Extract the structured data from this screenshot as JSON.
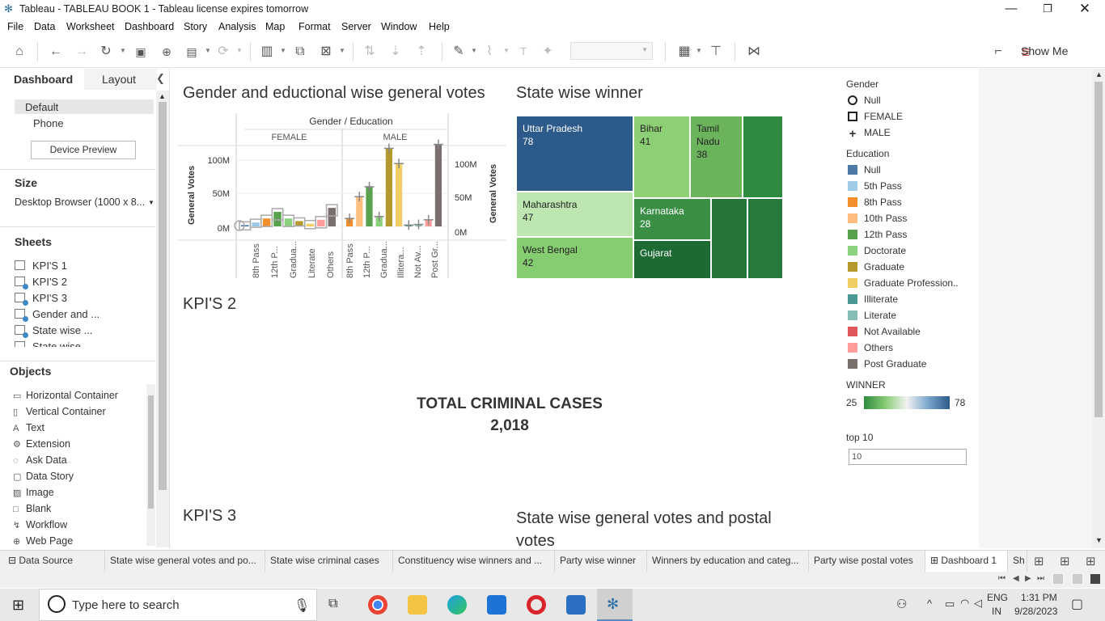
{
  "window": {
    "title": "Tableau - TABLEAU BOOK 1 - Tableau license expires tomorrow"
  },
  "menu": [
    "File",
    "Data",
    "Worksheet",
    "Dashboard",
    "Story",
    "Analysis",
    "Map",
    "Format",
    "Server",
    "Window",
    "Help"
  ],
  "toolbar": {
    "show_me": "Show Me"
  },
  "left_pane": {
    "tab_dashboard": "Dashboard",
    "tab_layout": "Layout",
    "devices": {
      "default": "Default",
      "phone": "Phone",
      "preview_button": "Device Preview"
    },
    "size": {
      "heading": "Size",
      "value": "Desktop Browser (1000 x 8..."
    },
    "sheets": {
      "heading": "Sheets",
      "items": [
        "KPI'S 1",
        "KPI'S 2",
        "KPI'S 3",
        "Gender and ...",
        "State wise ...",
        "State wise ..."
      ]
    },
    "objects": {
      "heading": "Objects",
      "items": [
        "Horizontal Container",
        "Vertical Container",
        "Text",
        "Extension",
        "Ask Data",
        "Data Story",
        "Image",
        "Blank",
        "Workflow",
        "Web Page"
      ]
    }
  },
  "dashboard": {
    "titles": {
      "gender_chart": "Gender and eductional wise general votes",
      "state_winner": "State wise winner",
      "kpi2": "KPI'S 2",
      "kpi3": "KPI'S 3",
      "state_votes": "State wise general votes and postal votes"
    },
    "kpi": {
      "label": "TOTAL CRIMINAL CASES",
      "value": "2,018"
    }
  },
  "chart_data": [
    {
      "type": "bar",
      "title": "Gender / Education",
      "ylabel": "General Votes",
      "y_ticks": [
        "100M",
        "50M",
        "0M"
      ],
      "ylim": [
        0,
        140
      ],
      "panels": [
        {
          "name": "FEMALE",
          "categories": [
            "",
            "8th Pass",
            "12th P...",
            "Gradua...",
            "Literate",
            "Others"
          ],
          "tick_labels": [
            "8th Pass",
            "12th P...",
            "Gradua...",
            "Literate",
            "Others"
          ],
          "values": [
            2,
            6,
            12,
            22,
            12,
            8,
            4,
            10,
            28
          ],
          "colors": [
            "#4e79a7",
            "#9fc9e8",
            "#f28e2b",
            "#59a14f",
            "#8cd17d",
            "#b6992d",
            "#f1ce63",
            "#ff9d9a",
            "#79706e"
          ]
        },
        {
          "name": "MALE",
          "categories": [
            "8th Pass",
            "12th P...",
            "Gradua...",
            "Illitera...",
            "Not Av...",
            "Post Gr..."
          ],
          "tick_labels": [
            "8th Pass",
            "12th P...",
            "Gradua...",
            "Illitera...",
            "Not Av...",
            "Post Gr..."
          ],
          "values": [
            12,
            45,
            60,
            15,
            118,
            95,
            2,
            3,
            10,
            124
          ],
          "colors": [
            "#f28e2b",
            "#ffbe7d",
            "#59a14f",
            "#8cd17d",
            "#b6992d",
            "#f1ce63",
            "#499894",
            "#86bcb6",
            "#ff9d9a",
            "#79706e"
          ]
        }
      ]
    },
    {
      "type": "treemap",
      "title": "State wise winner",
      "items": [
        {
          "label": "Uttar Pradesh",
          "value": 78
        },
        {
          "label": "Bihar",
          "value": 41
        },
        {
          "label": "Tamil Nadu",
          "value": 38
        },
        {
          "label": "Maharashtra",
          "value": 47
        },
        {
          "label": "West Bengal",
          "value": 42
        },
        {
          "label": "Karnataka",
          "value": 28
        },
        {
          "label": "Gujarat",
          "value": null
        }
      ]
    }
  ],
  "legend": {
    "gender": {
      "heading": "Gender",
      "items": [
        "Null",
        "FEMALE",
        "MALE"
      ]
    },
    "education": {
      "heading": "Education",
      "items": [
        {
          "label": "Null",
          "color": "#4e79a7"
        },
        {
          "label": "5th Pass",
          "color": "#a0cbe8"
        },
        {
          "label": "8th Pass",
          "color": "#f28e2b"
        },
        {
          "label": "10th Pass",
          "color": "#ffbe7d"
        },
        {
          "label": "12th Pass",
          "color": "#59a14f"
        },
        {
          "label": "Doctorate",
          "color": "#8cd17d"
        },
        {
          "label": "Graduate",
          "color": "#b6992d"
        },
        {
          "label": "Graduate Profession..",
          "color": "#f1ce63"
        },
        {
          "label": "Illiterate",
          "color": "#499894"
        },
        {
          "label": "Literate",
          "color": "#86bcb6"
        },
        {
          "label": "Not Available",
          "color": "#e15759"
        },
        {
          "label": "Others",
          "color": "#ff9d9a"
        },
        {
          "label": "Post Graduate",
          "color": "#79706e"
        }
      ]
    },
    "winner": {
      "heading": "WINNER",
      "min": "25",
      "max": "78"
    },
    "top10": {
      "heading": "top 10",
      "value": "10"
    }
  },
  "sheet_tabs": {
    "data_source": "Data Source",
    "tabs": [
      "State wise general votes and po...",
      "State wise criminal cases",
      "Constituency wise winners and ...",
      "Party wise winner",
      "Winners by education and categ...",
      "Party wise postal votes",
      "Dashboard 1",
      "Sh"
    ]
  },
  "taskbar": {
    "search_placeholder": "Type here to search",
    "lang1": "ENG",
    "lang2": "IN",
    "time": "1:31 PM",
    "date": "9/28/2023"
  }
}
